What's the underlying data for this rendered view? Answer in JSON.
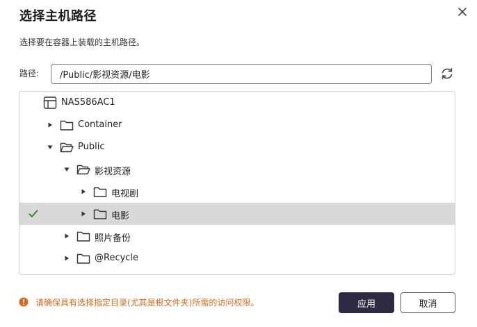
{
  "dialog": {
    "title": "选择主机路径",
    "description": "选择要在容器上装载的主机路径。"
  },
  "path": {
    "label": "路径:",
    "value": "/Public/影视资源/电影"
  },
  "tree": {
    "nodes": [
      {
        "label": "NAS586AC1",
        "type": "nas",
        "state": "none"
      },
      {
        "label": "Container",
        "type": "folder",
        "state": "collapsed"
      },
      {
        "label": "Public",
        "type": "folder",
        "state": "expanded"
      },
      {
        "label": "影视资源",
        "type": "folder",
        "state": "expanded"
      },
      {
        "label": "电视剧",
        "type": "folder",
        "state": "collapsed"
      },
      {
        "label": "电影",
        "type": "folder",
        "state": "collapsed",
        "selected": true
      },
      {
        "label": "照片备份",
        "type": "folder",
        "state": "collapsed"
      },
      {
        "label": "@Recycle",
        "type": "folder",
        "state": "collapsed"
      }
    ]
  },
  "footer": {
    "warning": "请确保具有选择指定目录(尤其是根文件夹)所需的访问权限。",
    "apply_label": "应用",
    "cancel_label": "取消"
  },
  "colors": {
    "accent": "#2f2a44",
    "selected_row": "#d8d8d8",
    "check": "#2e8b2e",
    "warning": "#d76a1e"
  },
  "icons": {
    "close": "close-icon",
    "refresh": "refresh-icon",
    "nas": "nas-icon",
    "folder": "folder-icon",
    "open_folder": "folder-open-icon",
    "check": "check-icon",
    "warning": "warning-icon"
  }
}
